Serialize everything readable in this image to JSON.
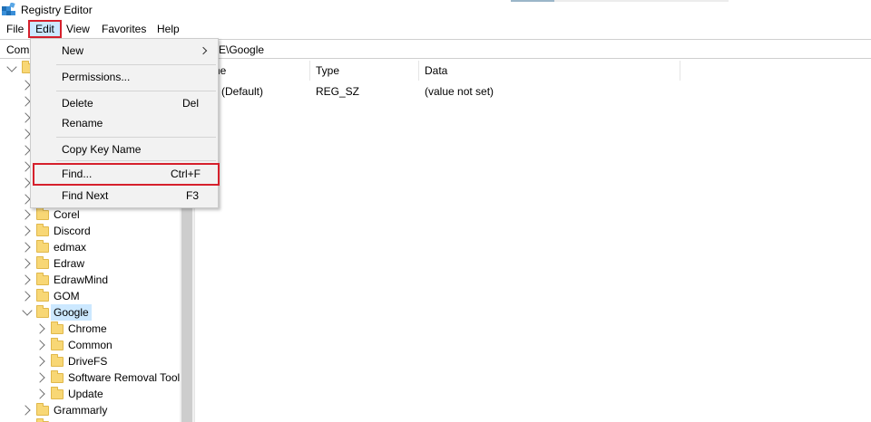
{
  "window": {
    "title": "Registry Editor"
  },
  "menu": {
    "file": "File",
    "edit": "Edit",
    "view": "View",
    "favorites": "Favorites",
    "help": "Help"
  },
  "address": {
    "prefix": "Com",
    "suffix": "E\\Google"
  },
  "columns": {
    "name": "ame",
    "type": "Type",
    "data": "Data"
  },
  "values": [
    {
      "name": "(Default)",
      "type": "REG_SZ",
      "data": "(value not set)"
    }
  ],
  "edit_menu": {
    "new": "New",
    "permissions": "Permissions...",
    "delete": "Delete",
    "delete_shortcut": "Del",
    "rename": "Rename",
    "copy_key_name": "Copy Key Name",
    "find": "Find...",
    "find_shortcut": "Ctrl+F",
    "find_next": "Find Next",
    "find_next_shortcut": "F3"
  },
  "tree": {
    "siblings": [
      "Corel",
      "Discord",
      "edmax",
      "Edraw",
      "EdrawMind",
      "GOM"
    ],
    "selected": "Google",
    "children": [
      "Chrome",
      "Common",
      "DriveFS",
      "Software Removal Tool",
      "Update"
    ],
    "after": "Grammarly"
  },
  "colors": {
    "selection": "#cce8ff",
    "highlight_box": "#d6202c",
    "folder": "#f8d775"
  }
}
